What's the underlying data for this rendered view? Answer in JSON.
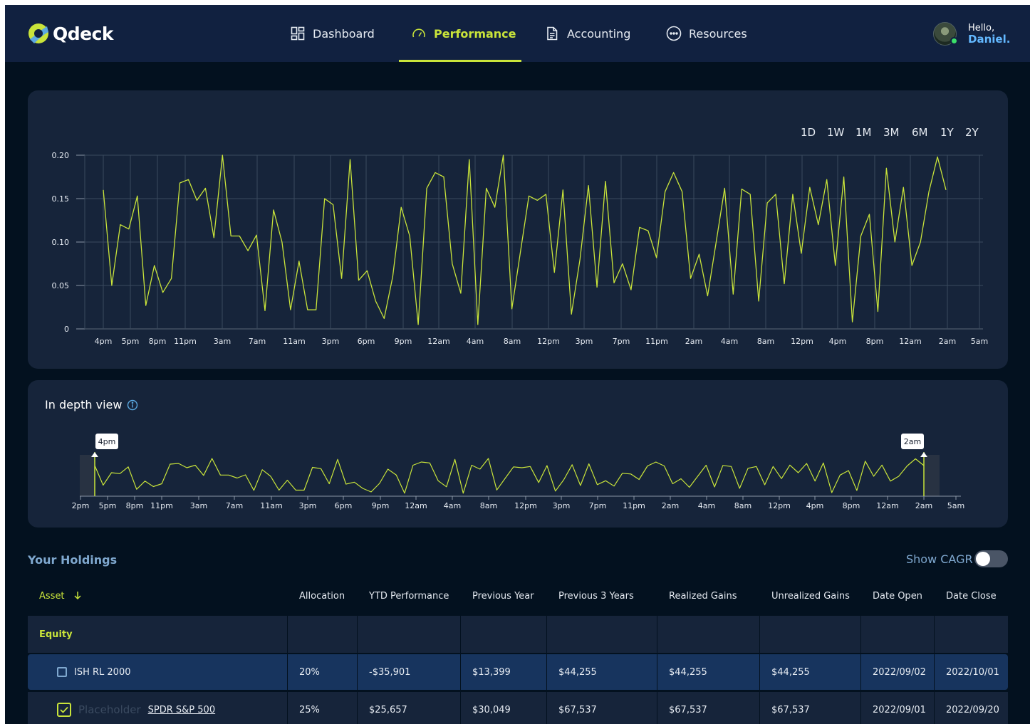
{
  "header": {
    "brand": "Qdeck",
    "nav": [
      {
        "label": "Dashboard",
        "icon": "dashboard-grid-icon",
        "active": false
      },
      {
        "label": "Performance",
        "icon": "gauge-icon",
        "active": true
      },
      {
        "label": "Accounting",
        "icon": "document-icon",
        "active": false
      },
      {
        "label": "Resources",
        "icon": "dots-circle-icon",
        "active": false
      }
    ],
    "greeting": "Hello,",
    "user_name": "Daniel."
  },
  "ranges": [
    "1D",
    "1W",
    "1M",
    "3M",
    "6M",
    "1Y",
    "2Y"
  ],
  "selected_range": "1D",
  "depth": {
    "title": "In depth view",
    "handle_left": "4pm",
    "handle_right": "2am",
    "x_ticks": [
      "2pm",
      "5pm",
      "8pm",
      "11pm",
      "3am",
      "7am",
      "11am",
      "3pm",
      "6pm",
      "9pm",
      "12am",
      "4am",
      "8am",
      "12pm",
      "3pm",
      "7pm",
      "11pm",
      "2am",
      "4am",
      "8am",
      "12pm",
      "4pm",
      "8pm",
      "12am",
      "2am",
      "5am"
    ]
  },
  "chart_data": {
    "type": "line",
    "title": "",
    "xlabel": "",
    "ylabel": "",
    "ylim": [
      0,
      0.2
    ],
    "y_ticks": [
      "0.20",
      "0.15",
      "0.10",
      "0.05",
      "0"
    ],
    "x_ticks": [
      "4pm",
      "5pm",
      "8pm",
      "11pm",
      "3am",
      "7am",
      "11am",
      "3pm",
      "6pm",
      "9pm",
      "12am",
      "4am",
      "8am",
      "12pm",
      "3pm",
      "7pm",
      "11pm",
      "2am",
      "4am",
      "8am",
      "12pm",
      "4pm",
      "8pm",
      "12am",
      "2am",
      "5am"
    ],
    "grid": true,
    "series": [
      {
        "color": "#c9e43a",
        "values": [
          0.16,
          0.05,
          0.12,
          0.115,
          0.153,
          0.027,
          0.073,
          0.042,
          0.058,
          0.168,
          0.172,
          0.148,
          0.162,
          0.105,
          0.2,
          0.107,
          0.107,
          0.09,
          0.108,
          0.021,
          0.137,
          0.1,
          0.022,
          0.078,
          0.022,
          0.022,
          0.15,
          0.143,
          0.058,
          0.195,
          0.056,
          0.067,
          0.032,
          0.012,
          0.06,
          0.14,
          0.107,
          0.005,
          0.162,
          0.18,
          0.175,
          0.075,
          0.041,
          0.195,
          0.005,
          0.162,
          0.14,
          0.2,
          0.023,
          0.088,
          0.153,
          0.148,
          0.155,
          0.065,
          0.16,
          0.017,
          0.08,
          0.165,
          0.048,
          0.17,
          0.053,
          0.075,
          0.045,
          0.117,
          0.113,
          0.082,
          0.158,
          0.18,
          0.158,
          0.058,
          0.086,
          0.038,
          0.1,
          0.162,
          0.04,
          0.161,
          0.155,
          0.032,
          0.145,
          0.155,
          0.052,
          0.155,
          0.087,
          0.163,
          0.12,
          0.172,
          0.073,
          0.175,
          0.008,
          0.107,
          0.132,
          0.02,
          0.185,
          0.1,
          0.163,
          0.073,
          0.1,
          0.158,
          0.198,
          0.16
        ]
      }
    ]
  },
  "holdings": {
    "title": "Your Holdings",
    "cagr_label": "Show CAGR",
    "columns": [
      "Asset",
      "Allocation",
      "YTD Performance",
      "Previous Year",
      "Previous 3 Years",
      "Realized Gains",
      "Unrealized Gains",
      "Date Open",
      "Date Close"
    ],
    "group": "Equity",
    "rows": [
      {
        "asset": "ISH RL 2000",
        "allocation": "20%",
        "ytd": "-$35,901",
        "prev_year": "$13,399",
        "prev_3y": "$44,255",
        "realized": "$44,255",
        "unrealized": "$44,255",
        "date_open": "2022/09/02",
        "date_close": "2022/10/01",
        "checked": false
      },
      {
        "asset": "SPDR S&P 500",
        "placeholder": "Placeholder",
        "allocation": "25%",
        "ytd": "$25,657",
        "prev_year": "$30,049",
        "prev_3y": "$67,537",
        "realized": "$67,537",
        "unrealized": "$67,537",
        "date_open": "2022/09/01",
        "date_close": "2022/09/20",
        "checked": true
      }
    ]
  }
}
